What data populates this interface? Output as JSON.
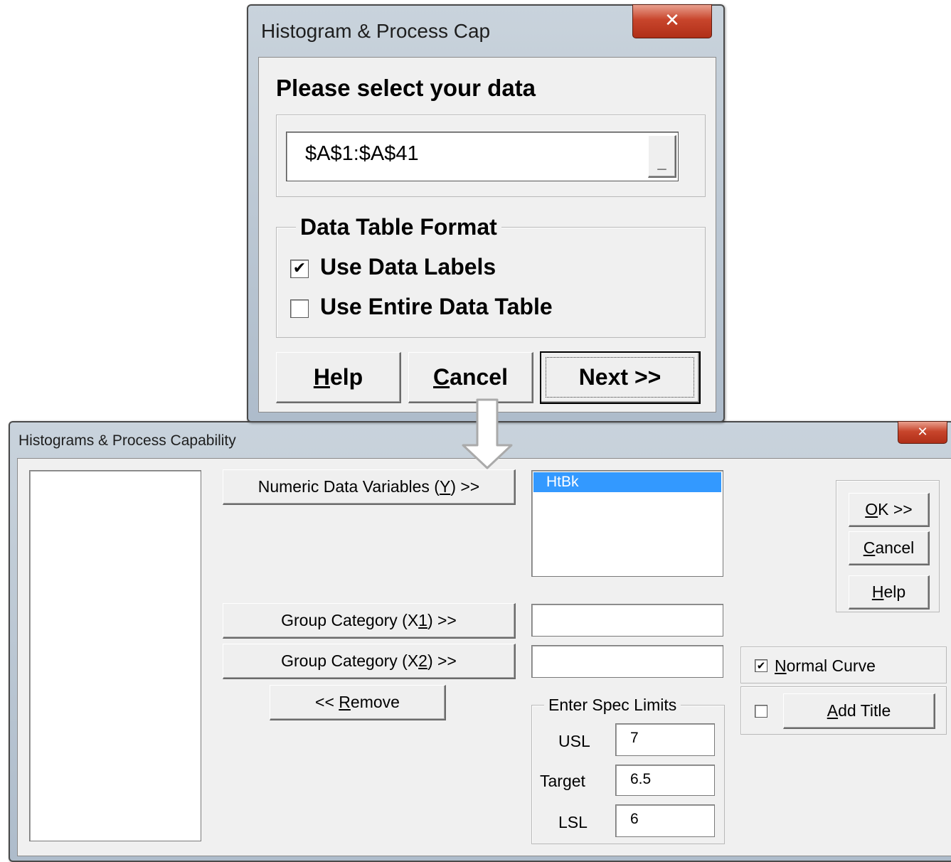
{
  "dialog1": {
    "title": "Histogram & Process Cap",
    "close_glyph": "✕",
    "prompt": "Please select your data",
    "range_value": "$A$1:$A$41",
    "range_button_glyph": "_",
    "format_group": "Data Table Format",
    "use_data_labels": {
      "label": "Use Data Labels",
      "checked": true
    },
    "use_entire_table": {
      "label": "Use Entire Data Table",
      "checked": false
    },
    "buttons": {
      "help": {
        "accel": "H",
        "rest": "elp"
      },
      "cancel": {
        "accel": "C",
        "rest": "ancel"
      },
      "next": "Next >>"
    }
  },
  "dialog2": {
    "title": "Histograms & Process Capability",
    "close_glyph": "✕",
    "numeric_button": {
      "pre": "Numeric Data Variables (",
      "accel": "Y",
      "post": ") >>"
    },
    "numeric_list": [
      "HtBk"
    ],
    "group1_button": {
      "pre": "Group Category (X",
      "accel": "1",
      "post": ") >>"
    },
    "group2_button": {
      "pre": "Group Category (X",
      "accel": "2",
      "post": ") >>"
    },
    "remove_button": {
      "pre": "<< ",
      "accel": "R",
      "post": "emove"
    },
    "spec_limits": {
      "legend": "Enter Spec Limits",
      "usl": {
        "label": "USL",
        "value": "7"
      },
      "target": {
        "label": "Target",
        "value": "6.5"
      },
      "lsl": {
        "label": "LSL",
        "value": "6"
      }
    },
    "ok_button": {
      "accel": "O",
      "rest": "K >>"
    },
    "cancel_button": {
      "accel": "C",
      "rest": "ancel"
    },
    "help_button": {
      "accel": "H",
      "rest": "elp"
    },
    "normal_curve": {
      "accel": "N",
      "rest": "ormal Curve",
      "checked": true
    },
    "add_title": {
      "accel": "A",
      "rest": "dd Title",
      "checked": false
    }
  },
  "check_glyph": "✔",
  "arrow_color": "#aaaaaa"
}
